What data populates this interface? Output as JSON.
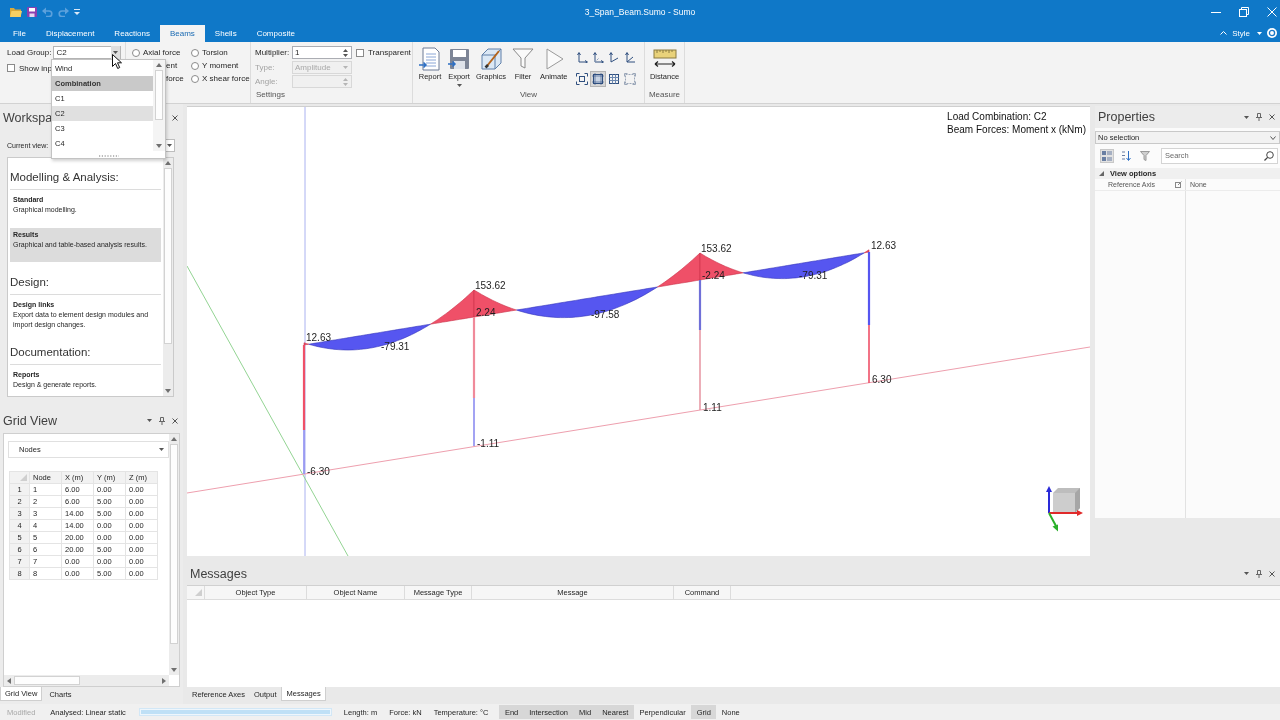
{
  "window": {
    "title": "3_Span_Beam.Sumo - Sumo"
  },
  "quick_access": [
    {
      "kind": "open",
      "disabled": false
    },
    {
      "kind": "save",
      "disabled": false
    },
    {
      "kind": "undo",
      "disabled": true
    },
    {
      "kind": "redo",
      "disabled": true
    },
    {
      "kind": "customize",
      "disabled": false
    }
  ],
  "ribbon_tabs": [
    {
      "label": "File",
      "selected": false
    },
    {
      "label": "Displacement",
      "selected": false
    },
    {
      "label": "Reactions",
      "selected": false
    },
    {
      "label": "Beams",
      "selected": true
    },
    {
      "label": "Shells",
      "selected": false
    },
    {
      "label": "Composite",
      "selected": false
    }
  ],
  "style_menu": {
    "label": "Style"
  },
  "ribbon": {
    "load_group": {
      "label": "Load Group:",
      "value": "C2",
      "show_input": {
        "label": "Show inp",
        "checked": false
      }
    },
    "result_options": [
      {
        "kind": "radio",
        "label": "Axial force",
        "selected": false
      },
      {
        "kind": "radio",
        "label": "Torsion",
        "selected": false
      },
      {
        "kind": "cut",
        "label": "ent"
      },
      {
        "kind": "radio",
        "label": "Y moment",
        "selected": false
      },
      {
        "kind": "cut",
        "label": "force"
      },
      {
        "kind": "radio",
        "label": "X shear force",
        "selected": false
      }
    ],
    "settings": {
      "fields": [
        {
          "kind": "spin",
          "label": "Multiplier:",
          "value": "1",
          "disabled": false
        },
        {
          "kind": "combo",
          "label": "Type:",
          "value": "Amplitude",
          "disabled": true
        },
        {
          "kind": "spin",
          "label": "Angle:",
          "disabled": true
        }
      ],
      "transparent": {
        "label": "Transparent",
        "checked": false
      },
      "group_label": "Settings"
    },
    "view": {
      "buttons": [
        {
          "kind": "report",
          "label": "Report",
          "has_menu": false
        },
        {
          "kind": "export",
          "label": "Export",
          "has_menu": true
        },
        {
          "kind": "graphics",
          "label": "Graphics",
          "has_menu": false
        },
        {
          "kind": "filter",
          "label": "Filter",
          "has_menu": false
        },
        {
          "kind": "animate",
          "label": "Animate",
          "has_menu": false
        }
      ],
      "tools": [
        {
          "kind": "axes-yx",
          "selected": false
        },
        {
          "kind": "axes-zx",
          "selected": false
        },
        {
          "kind": "axes-yz",
          "selected": false
        },
        {
          "kind": "axes-zyx",
          "selected": false
        },
        {
          "kind": "zoom-extents",
          "selected": false
        },
        {
          "kind": "frame",
          "selected": true
        },
        {
          "kind": "grid",
          "selected": false
        },
        {
          "kind": "zoom-selection",
          "selected": false
        }
      ],
      "group_label": "View"
    },
    "measure": {
      "buttons": [
        {
          "kind": "distance",
          "label": "Distance",
          "has_menu": false
        }
      ],
      "group_label": "Measure"
    }
  },
  "load_group_dropdown": {
    "options": [
      {
        "kind": "option",
        "label": "Wind",
        "selected": false
      },
      {
        "kind": "header",
        "label": "Combination"
      },
      {
        "kind": "option",
        "label": "C1",
        "selected": false
      },
      {
        "kind": "option",
        "label": "C2",
        "selected": true
      },
      {
        "kind": "option",
        "label": "C3",
        "selected": false
      },
      {
        "kind": "option",
        "label": "C4",
        "selected": false
      }
    ]
  },
  "workspace_panel": {
    "title": "Workspa",
    "current_view_label": "Current view:",
    "sections": [
      {
        "heading": "Modelling & Analysis:",
        "items": [
          {
            "title": "Standard",
            "description": "Graphical modelling.",
            "selected": false
          },
          {
            "title": "Results",
            "description": "Graphical and table-based analysis results.",
            "selected": true
          }
        ]
      },
      {
        "heading": "Design:",
        "items": [
          {
            "title": "Design links",
            "description": "Export data to element design modules and import design changes.",
            "selected": false
          }
        ]
      },
      {
        "heading": "Documentation:",
        "items": [
          {
            "title": "Reports",
            "description": "Design & generate reports.",
            "selected": false
          }
        ]
      }
    ]
  },
  "grid_view_panel": {
    "title": "Grid View",
    "table_selector": "Nodes",
    "table": {
      "columns": [
        "Node",
        "X (m)",
        "Y (m)",
        "Z (m)"
      ],
      "rows": [
        {
          "number": "1",
          "cells": [
            "1",
            "6.00",
            "0.00",
            "0.00"
          ]
        },
        {
          "number": "2",
          "cells": [
            "2",
            "6.00",
            "5.00",
            "0.00"
          ]
        },
        {
          "number": "3",
          "cells": [
            "3",
            "14.00",
            "5.00",
            "0.00"
          ]
        },
        {
          "number": "4",
          "cells": [
            "4",
            "14.00",
            "0.00",
            "0.00"
          ]
        },
        {
          "number": "5",
          "cells": [
            "5",
            "20.00",
            "0.00",
            "0.00"
          ]
        },
        {
          "number": "6",
          "cells": [
            "6",
            "20.00",
            "5.00",
            "0.00"
          ]
        },
        {
          "number": "7",
          "cells": [
            "7",
            "0.00",
            "0.00",
            "0.00"
          ]
        },
        {
          "number": "8",
          "cells": [
            "8",
            "0.00",
            "5.00",
            "0.00"
          ]
        }
      ]
    }
  },
  "left_tabs": [
    {
      "label": "Grid View",
      "selected": true
    },
    {
      "label": "Charts",
      "selected": false
    }
  ],
  "viewport": {
    "captions": [
      "Load Combination: C2",
      "Beam Forces: Moment x (kNm)"
    ],
    "diagram_labels": [
      "12.63",
      "-79.31",
      "153.62",
      "2.24",
      "-97.58",
      "153.62",
      "-2.24",
      "-79.31",
      "12.63",
      "-6.30",
      "-1.11",
      "1.11",
      "6.30"
    ]
  },
  "properties_panel": {
    "title": "Properties",
    "selection": "No selection",
    "tools": [
      {
        "kind": "categorized",
        "selected": true
      },
      {
        "kind": "alphabetical",
        "selected": false
      },
      {
        "kind": "filter",
        "selected": false
      }
    ],
    "search": {
      "placeholder": "Search"
    },
    "groups": [
      {
        "label": "View options",
        "expanded": true,
        "rows": [
          {
            "name": "Reference Axis",
            "value": "None"
          }
        ]
      }
    ]
  },
  "messages_panel": {
    "title": "Messages",
    "columns": [
      "Object Type",
      "Object Name",
      "Message Type",
      "Message",
      "Command"
    ]
  },
  "bottom_tabs": [
    {
      "label": "Reference Axes",
      "selected": false
    },
    {
      "label": "Output",
      "selected": false
    },
    {
      "label": "Messages",
      "selected": true
    }
  ],
  "status_bar": {
    "modified": {
      "label": "Modified",
      "active": false
    },
    "analysis": "Analysed: Linear static",
    "progress": {
      "level": 1
    },
    "units": [
      "Length: m",
      "Force: kN",
      "Temperature: °C"
    ],
    "snaps": [
      {
        "label": "End",
        "on": true
      },
      {
        "label": "Intersection",
        "on": true
      },
      {
        "label": "Mid",
        "on": true
      },
      {
        "label": "Nearest",
        "on": true
      },
      {
        "label": "Perpendicular",
        "on": false
      },
      {
        "label": "Grid",
        "on": true
      },
      {
        "label": "None",
        "on": false
      }
    ]
  }
}
